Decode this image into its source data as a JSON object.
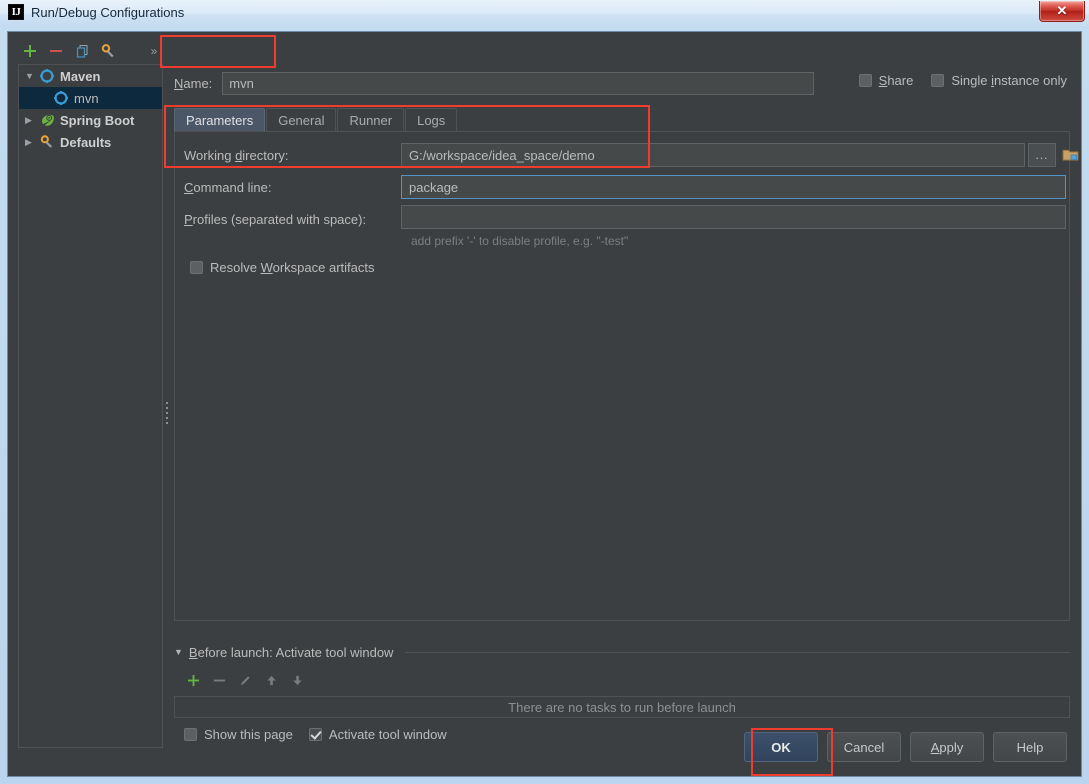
{
  "window": {
    "title": "Run/Debug Configurations",
    "logo_text": "IJ",
    "close_label": "✕"
  },
  "sidebar": {
    "toolbar": [
      {
        "name": "add-configuration-button",
        "icon": "plus-icon",
        "label": "+"
      },
      {
        "name": "remove-configuration-button",
        "icon": "minus-icon",
        "label": "−"
      },
      {
        "name": "copy-configuration-button",
        "icon": "copy-icon",
        "label": ""
      },
      {
        "name": "edit-templates-button",
        "icon": "wrench-icon",
        "label": ""
      },
      {
        "name": "more-options-button",
        "icon": "chevron-double-right-icon",
        "label": "»"
      }
    ],
    "tree": [
      {
        "label": "Maven",
        "level": 1,
        "expanded": true,
        "twisty": "▼",
        "icon": "maven-gear-icon",
        "selected": false,
        "group": true
      },
      {
        "label": "mvn",
        "level": 2,
        "expanded": false,
        "twisty": "",
        "icon": "maven-gear-icon",
        "selected": true,
        "group": false
      },
      {
        "label": "Spring Boot",
        "level": 1,
        "expanded": false,
        "twisty": "▶",
        "icon": "spring-boot-leaf-icon",
        "selected": false,
        "group": true
      },
      {
        "label": "Defaults",
        "level": 1,
        "expanded": false,
        "twisty": "▶",
        "icon": "defaults-wrench-icon",
        "selected": false,
        "group": true
      }
    ]
  },
  "header": {
    "name_label": "Name:",
    "name_label_mnemonic": "N",
    "name_value": "mvn",
    "name_placeholder": "",
    "share_label": "Share",
    "share_mnemonic": "S",
    "share_checked": false,
    "single_instance_label": "Single instance only",
    "single_instance_mnemonic": "i",
    "single_instance_checked": false
  },
  "tabs": [
    {
      "label": "Parameters",
      "active": true
    },
    {
      "label": "General",
      "active": false
    },
    {
      "label": "Runner",
      "active": false
    },
    {
      "label": "Logs",
      "active": false
    }
  ],
  "parameters": {
    "working_directory_label": "Working directory:",
    "working_directory_mnemonic": "d",
    "working_directory_value": "G:/workspace/idea_space/demo",
    "browse_label": "...",
    "command_line_label": "Command line:",
    "command_line_mnemonic": "C",
    "command_line_value": "package",
    "profiles_label": "Profiles (separated with space):",
    "profiles_mnemonic": "P",
    "profiles_value": "",
    "profiles_hint": "add prefix '-' to disable profile, e.g. \"-test\"",
    "resolve_workspace_label": "Resolve Workspace artifacts",
    "resolve_workspace_mnemonic": "W",
    "resolve_workspace_checked": false
  },
  "before_launch": {
    "title": "Before launch: Activate tool window",
    "title_mnemonic": "B",
    "twisty": "▼",
    "toolbar": [
      {
        "name": "add-task-button",
        "icon": "plus-icon"
      },
      {
        "name": "remove-task-button",
        "icon": "minus-icon"
      },
      {
        "name": "edit-task-button",
        "icon": "pencil-icon"
      },
      {
        "name": "move-task-up-button",
        "icon": "arrow-up-icon"
      },
      {
        "name": "move-task-down-button",
        "icon": "arrow-down-icon"
      }
    ],
    "empty_text": "There are no tasks to run before launch",
    "show_page_label": "Show this page",
    "show_page_checked": false,
    "activate_tool_window_label": "Activate tool window",
    "activate_tool_window_checked": true
  },
  "buttons": {
    "ok": "OK",
    "cancel": "Cancel",
    "apply": "Apply",
    "apply_mnemonic": "A",
    "help": "Help"
  },
  "colors": {
    "panel_bg": "#3c3f41",
    "field_bg": "#45494a",
    "selection_bg": "#0d293e",
    "accent_focus": "#5394c8",
    "annotation": "#f03c2e",
    "tab_active": "#4b5667",
    "text": "#bbbbbb",
    "titlebar": "#cfe2f4"
  }
}
